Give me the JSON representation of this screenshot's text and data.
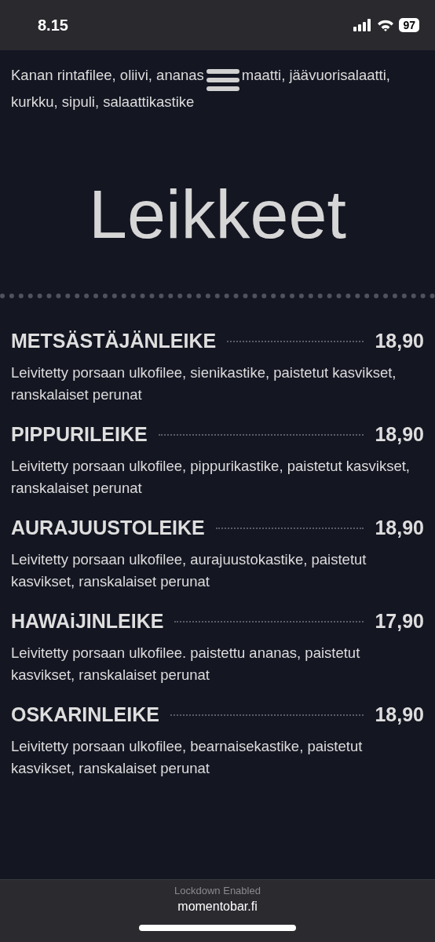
{
  "status_bar": {
    "time": "8.15",
    "battery": "97"
  },
  "intro_text": [
    "Kanan rintafilee, oliivi, ananas",
    "maatti, jäävuorisalaatti,",
    "kurkku, sipuli, salaattikastike"
  ],
  "section_title": "Leikkeet",
  "items": [
    {
      "name": "METSÄSTÄJÄNLEIKE",
      "price": "18,90",
      "description": "Leivitetty porsaan ulkofilee, sienikastike, paistetut kasvikset, ranskalaiset perunat"
    },
    {
      "name": "PIPPURILEIKE",
      "price": "18,90",
      "description": "Leivitetty porsaan ulkofilee, pippurikastike, paistetut kasvikset, ranskalaiset perunat"
    },
    {
      "name": "AURAJUUSTOLEIKE",
      "price": "18,90",
      "description": "Leivitetty porsaan ulkofilee, aurajuustokastike, paistetut kasvikset, ranskalaiset perunat"
    },
    {
      "name": "HAWAiJINLEIKE",
      "price": "17,90",
      "description": "Leivitetty porsaan ulkofilee. paistettu ananas, paistetut kasvikset, ranskalaiset perunat"
    },
    {
      "name": "OSKARINLEIKE",
      "price": "18,90",
      "description": "Leivitetty porsaan ulkofilee, bearnaisekastike, paistetut kasvikset, ranskalaiset perunat"
    }
  ],
  "browser_bar": {
    "notice": "Lockdown Enabled",
    "url": "momentobar.fi"
  }
}
